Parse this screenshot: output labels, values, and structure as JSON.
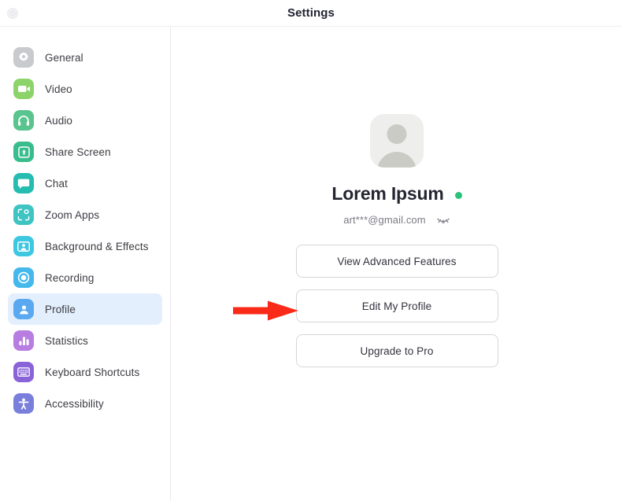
{
  "window": {
    "title": "Settings",
    "close_button_label": "Close"
  },
  "sidebar": {
    "items": [
      {
        "label": "General",
        "icon": "gear-icon",
        "color": "#c9cacd",
        "active": false
      },
      {
        "label": "Video",
        "icon": "video-camera-icon",
        "color": "#8cd36a",
        "active": false
      },
      {
        "label": "Audio",
        "icon": "headphones-icon",
        "color": "#5ac48f",
        "active": false
      },
      {
        "label": "Share Screen",
        "icon": "share-screen-icon",
        "color": "#39bd8d",
        "active": false
      },
      {
        "label": "Chat",
        "icon": "chat-bubble-icon",
        "color": "#26bcb0",
        "active": false
      },
      {
        "label": "Zoom Apps",
        "icon": "zoom-apps-icon",
        "color": "#3ec4c2",
        "active": false
      },
      {
        "label": "Background & Effects",
        "icon": "background-effects-icon",
        "color": "#3ec7e0",
        "active": false
      },
      {
        "label": "Recording",
        "icon": "recording-icon",
        "color": "#45b8ec",
        "active": false
      },
      {
        "label": "Profile",
        "icon": "profile-person-icon",
        "color": "#5aa9f0",
        "active": true
      },
      {
        "label": "Statistics",
        "icon": "bar-chart-icon",
        "color": "#b77de0",
        "active": false
      },
      {
        "label": "Keyboard Shortcuts",
        "icon": "keyboard-icon",
        "color": "#8a63d8",
        "active": false
      },
      {
        "label": "Accessibility",
        "icon": "accessibility-icon",
        "color": "#7a7fdc",
        "active": false
      }
    ],
    "active_highlight_color": "#e3effc"
  },
  "profile": {
    "avatar_icon": "avatar-placeholder-icon",
    "display_name": "Lorem Ipsum",
    "status": "available",
    "status_color": "#2bc17c",
    "email": "art***@gmail.com",
    "email_visibility_icon": "eye-hidden-icon",
    "buttons": [
      {
        "label": "View Advanced Features",
        "name": "view-advanced-features-button"
      },
      {
        "label": "Edit My Profile",
        "name": "edit-my-profile-button"
      },
      {
        "label": "Upgrade to Pro",
        "name": "upgrade-to-pro-button"
      }
    ]
  },
  "annotation": {
    "arrow_color": "#f92a18",
    "points_at": "Edit My Profile"
  }
}
